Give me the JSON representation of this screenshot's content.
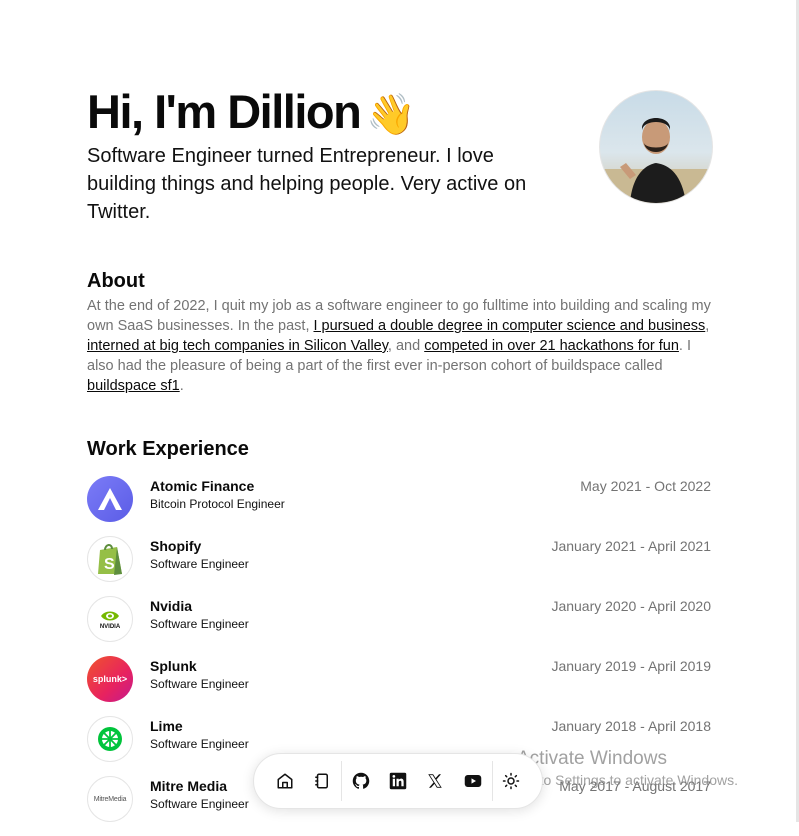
{
  "hero": {
    "title": "Hi, I'm Dillion",
    "wave": "👋",
    "subtitle": "Software Engineer turned Entrepreneur. I love building things and helping people. Very active on Twitter."
  },
  "about": {
    "heading": "About",
    "t1": "At the end of 2022, I quit my job as a software engineer to go fulltime into building and scaling my own SaaS businesses. In the past, ",
    "l1": "I pursued a double degree in computer science and business",
    "t2": ", ",
    "l2": "interned at big tech companies in Silicon Valley",
    "t3": ", and ",
    "l3": "competed in over 21 hackathons for fun",
    "t4": ". I also had the pleasure of being a part of the first ever in-person cohort of buildspace called ",
    "l4": "buildspace sf1",
    "t5": "."
  },
  "work": {
    "heading": "Work Experience",
    "items": [
      {
        "company": "Atomic Finance",
        "role": "Bitcoin Protocol Engineer",
        "dates": "May 2021 - Oct 2022",
        "logo": "atomic-finance-logo"
      },
      {
        "company": "Shopify",
        "role": "Software Engineer",
        "dates": "January 2021 - April 2021",
        "logo": "shopify-logo"
      },
      {
        "company": "Nvidia",
        "role": "Software Engineer",
        "dates": "January 2020 - April 2020",
        "logo": "nvidia-logo",
        "logo_text": "NVIDIA"
      },
      {
        "company": "Splunk",
        "role": "Software Engineer",
        "dates": "January 2019 - April 2019",
        "logo": "splunk-logo",
        "logo_text": "splunk>"
      },
      {
        "company": "Lime",
        "role": "Software Engineer",
        "dates": "January 2018 - April 2018",
        "logo": "lime-logo"
      },
      {
        "company": "Mitre Media",
        "role": "Software Engineer",
        "dates": "May 2017 - August 2017",
        "logo": "mitre-media-logo",
        "logo_text": "MitreMedia"
      }
    ]
  },
  "dock": {
    "items": [
      "home-icon",
      "notebook-icon",
      "github-icon",
      "linkedin-icon",
      "x-icon",
      "youtube-icon",
      "sun-icon"
    ]
  },
  "watermark": {
    "title": "Activate Windows",
    "subtitle": "Go to Settings to activate Windows."
  },
  "colors": {
    "text": "#0a0a0a",
    "muted": "#737373",
    "border": "#e5e5e5",
    "atomic": "#6b6cf0",
    "shopify": "#95bf47",
    "nvidia": "#76b900",
    "splunk": "#e8225f",
    "lime": "#00c43b"
  }
}
